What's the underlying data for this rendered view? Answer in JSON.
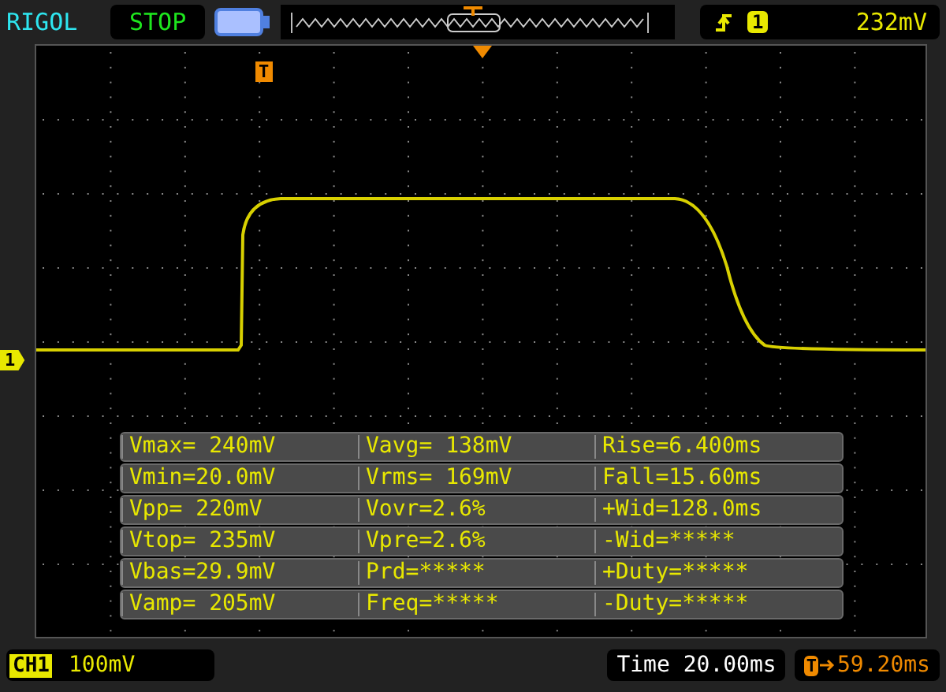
{
  "brand": "RIGOL",
  "run_state": "STOP",
  "trigger": {
    "channel": "1",
    "level": "232mV"
  },
  "trigger_marker": "T",
  "channel_marker": "1",
  "measurements": [
    [
      "Vmax= 240mV",
      "Vavg= 138mV",
      "Rise=6.400ms"
    ],
    [
      "Vmin=20.0mV",
      "Vrms= 169mV",
      "Fall=15.60ms"
    ],
    [
      "Vpp= 220mV",
      "Vovr=2.6%",
      "+Wid=128.0ms"
    ],
    [
      "Vtop= 235mV",
      "Vpre=2.6%",
      "-Wid=*****"
    ],
    [
      "Vbas=29.9mV",
      "Prd=*****",
      "+Duty=*****"
    ],
    [
      "Vamp= 205mV",
      "Freq=*****",
      "-Duty=*****"
    ]
  ],
  "status": {
    "channel": "CH1",
    "scale": "100mV",
    "time": "Time 20.00ms",
    "offset_marker": "T",
    "offset": "59.20ms"
  }
}
